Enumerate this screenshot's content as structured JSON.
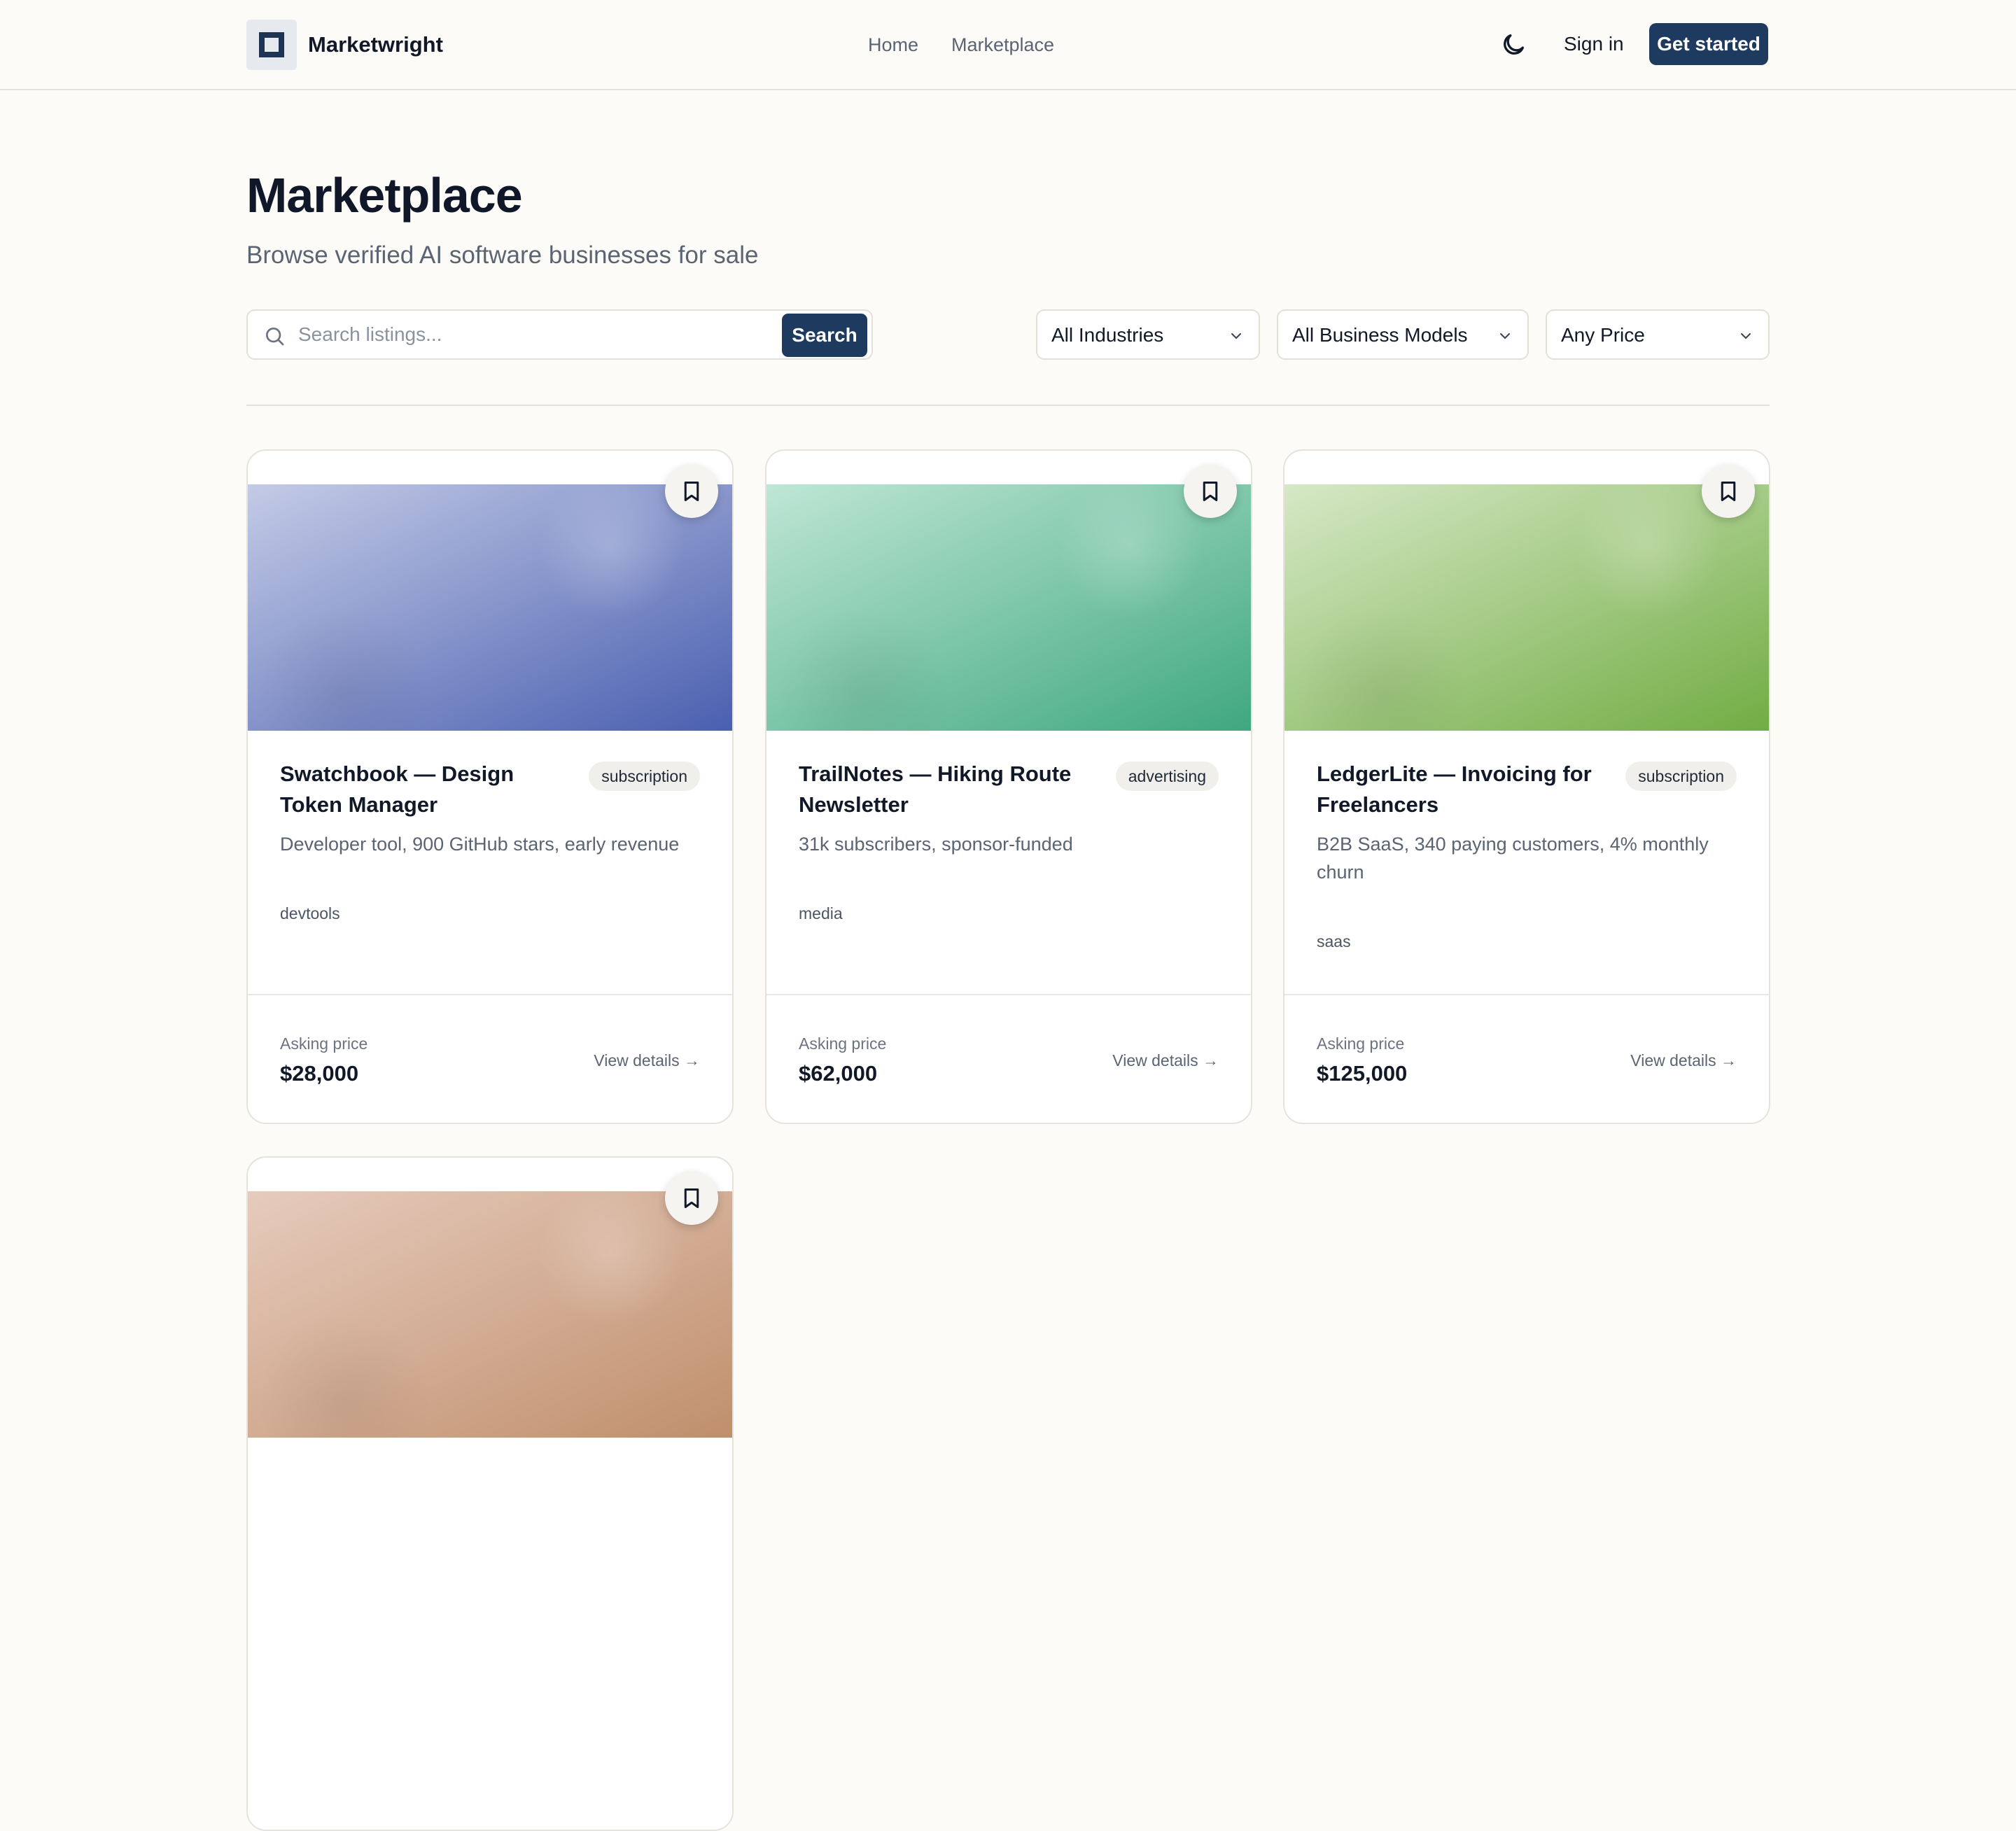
{
  "header": {
    "brand": "Marketwright",
    "nav": [
      "Home",
      "Marketplace"
    ],
    "sign_in": "Sign in",
    "get_started": "Get started",
    "theme_icon": "moon-icon"
  },
  "page": {
    "title": "Marketplace",
    "subtitle": "Browse verified AI software businesses for sale"
  },
  "search": {
    "placeholder": "Search listings...",
    "value": "",
    "button": "Search"
  },
  "filters": {
    "industry": "All Industries",
    "business_model": "All Business Models",
    "price": "Any Price"
  },
  "colors": {
    "accent": "#1e3a5f",
    "background": "#fcfbf8"
  },
  "listings": [
    {
      "title": "Swatchbook — Design Token Manager",
      "badge": "subscription",
      "description": "Developer tool, 900 GitHub stars, early revenue",
      "tag": "devtools",
      "asking_label": "Asking price",
      "price": "$28,000",
      "details": "View details →",
      "gradient": [
        "#c4cbe6",
        "#4a5fb0"
      ]
    },
    {
      "title": "TrailNotes — Hiking Route Newsletter",
      "badge": "advertising",
      "description": "31k subscribers, sponsor-funded",
      "tag": "media",
      "asking_label": "Asking price",
      "price": "$62,000",
      "details": "View details →",
      "gradient": [
        "#bfe6d6",
        "#3fa880"
      ]
    },
    {
      "title": "LedgerLite — Invoicing for Freelancers",
      "badge": "subscription",
      "description": "B2B SaaS, 340 paying customers, 4% monthly churn",
      "tag": "saas",
      "asking_label": "Asking price",
      "price": "$125,000",
      "details": "View details →",
      "gradient": [
        "#d6e8c6",
        "#72ad44"
      ]
    },
    {
      "gradient": [
        "#e6cbbd",
        "#c08f6c"
      ]
    }
  ]
}
